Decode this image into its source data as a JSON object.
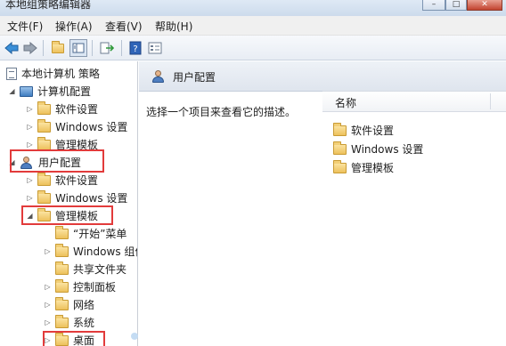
{
  "window": {
    "title": "本地组策略编辑器"
  },
  "menu": [
    {
      "label": "文件(F)"
    },
    {
      "label": "操作(A)"
    },
    {
      "label": "查看(V)"
    },
    {
      "label": "帮助(H)"
    }
  ],
  "toolbar": {
    "buttons": [
      "back-arrow-icon",
      "forward-arrow-icon",
      "up-folder-icon",
      "show-hide-tree-icon",
      "export-list-icon",
      "help-icon",
      "properties-icon"
    ]
  },
  "tree": {
    "root": "本地计算机 策略",
    "computer_config": "计算机配置",
    "cc_software": "软件设置",
    "cc_windows": "Windows 设置",
    "cc_admin": "管理模板",
    "user_config": "用户配置",
    "uc_software": "软件设置",
    "uc_windows": "Windows 设置",
    "uc_admin": "管理模板",
    "at_start": "“开始”菜单",
    "at_windows": "Windows 组件",
    "at_shared": "共享文件夹",
    "at_control": "控制面板",
    "at_network": "网络",
    "at_system": "系统",
    "at_desktop": "桌面"
  },
  "right_pane": {
    "title": "用户配置",
    "description": "选择一个项目来查看它的描述。",
    "column_header": "名称",
    "items": [
      "软件设置",
      "Windows 设置",
      "管理模板"
    ]
  },
  "colors": {
    "highlight_box": "#e23b3b",
    "folder": "#edc15c",
    "accent": "#3f7cc1"
  }
}
